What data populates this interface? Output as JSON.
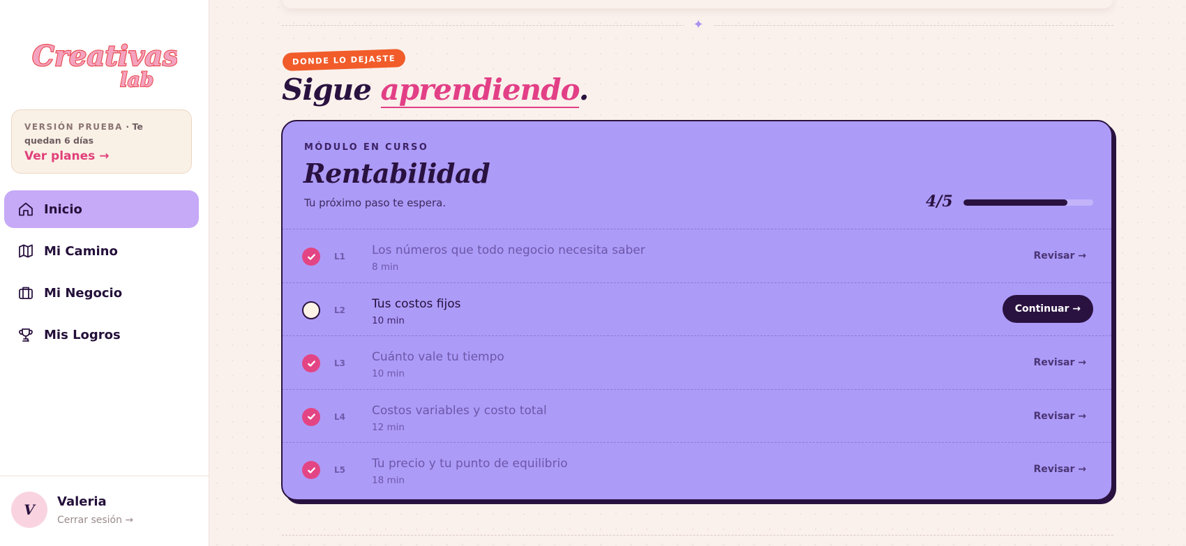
{
  "brand": {
    "logo_line1": "Creativas",
    "logo_line2": "lab"
  },
  "trial": {
    "tag": "VERSIÓN PRUEBA",
    "rest": " · Te quedan 6 días",
    "link": "Ver planes →"
  },
  "nav": {
    "items": [
      {
        "label": "Inicio",
        "icon": "home-icon"
      },
      {
        "label": "Mi Camino",
        "icon": "map-icon"
      },
      {
        "label": "Mi Negocio",
        "icon": "briefcase-icon"
      },
      {
        "label": "Mis Logros",
        "icon": "trophy-icon"
      }
    ]
  },
  "user": {
    "initial": "V",
    "name": "Valeria",
    "logout": "Cerrar sesión →"
  },
  "section": {
    "badge": "DONDE LO DEJASTE",
    "heading_part1": "Sigue ",
    "heading_accent": "aprendiendo",
    "heading_end": "."
  },
  "module": {
    "eyebrow": "MÓDULO EN CURSO",
    "title": "Rentabilidad",
    "subtitle": "Tu próximo paso te espera.",
    "progress_label": "4/5",
    "progress_fraction": 0.8,
    "lessons": [
      {
        "code": "L1",
        "title": "Los números que todo negocio necesita saber",
        "duration": "8 min",
        "done": true,
        "action": "Revisar →"
      },
      {
        "code": "L2",
        "title": "Tus costos fijos",
        "duration": "10 min",
        "done": false,
        "action": "Continuar →"
      },
      {
        "code": "L3",
        "title": "Cuánto vale tu tiempo",
        "duration": "10 min",
        "done": true,
        "action": "Revisar →"
      },
      {
        "code": "L4",
        "title": "Costos variables y costo total",
        "duration": "12 min",
        "done": true,
        "action": "Revisar →"
      },
      {
        "code": "L5",
        "title": "Tu precio y tu punto de equilibrio",
        "duration": "18 min",
        "done": true,
        "action": "Revisar →"
      }
    ]
  },
  "colors": {
    "accent_pink": "#e23f86",
    "badge_orange": "#f15c2a",
    "card_purple": "#ad9bf8",
    "nav_active": "#c6a9f7",
    "dark": "#2a1240"
  }
}
